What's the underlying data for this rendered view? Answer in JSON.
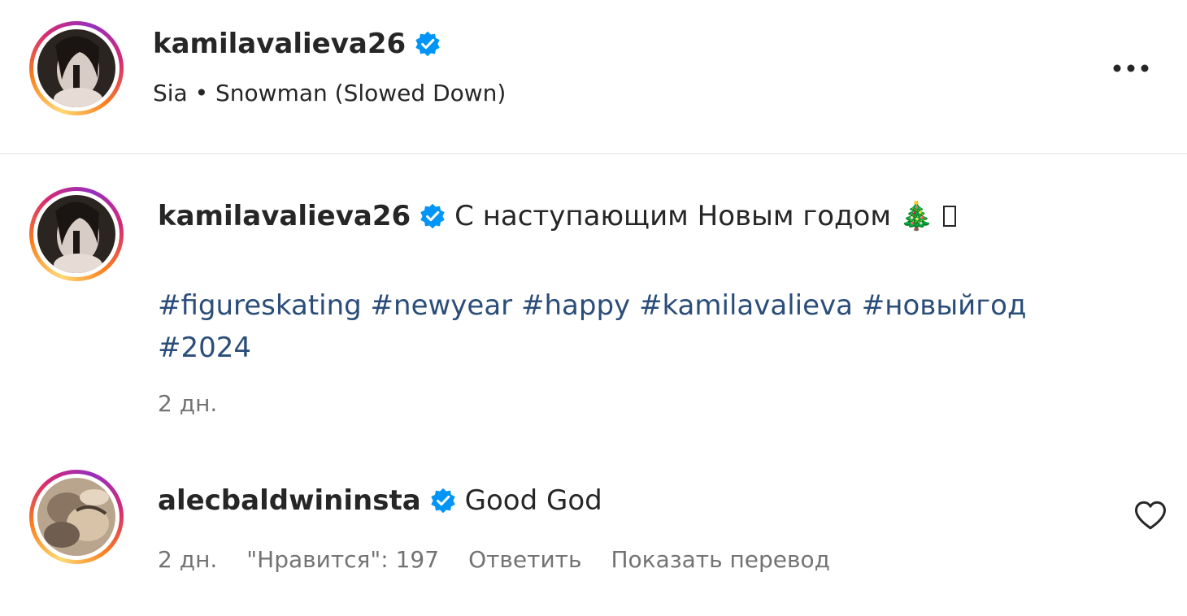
{
  "header": {
    "username": "kamilavalieva26",
    "audio": "Sia • Snowman (Slowed Down)",
    "more_icon": "more-horizontal-icon"
  },
  "caption": {
    "username": "kamilavalieva26",
    "text": "С наступающим Новым годом",
    "emoji": "🎄",
    "hashtags": [
      "#figureskating",
      "#newyear",
      "#happy",
      "#kamilavalieva",
      "#новыйгод",
      "#2024"
    ],
    "time": "2 дн."
  },
  "comment": {
    "username": "alecbaldwininsta",
    "text": "Good God",
    "time": "2 дн.",
    "likes": "\"Нравится\": 197",
    "reply": "Ответить",
    "translate": "Показать перевод"
  },
  "colors": {
    "verified": "#0095f6",
    "hashtag": "#2a4d79",
    "secondary_text": "#737373",
    "primary_text": "#262626"
  }
}
